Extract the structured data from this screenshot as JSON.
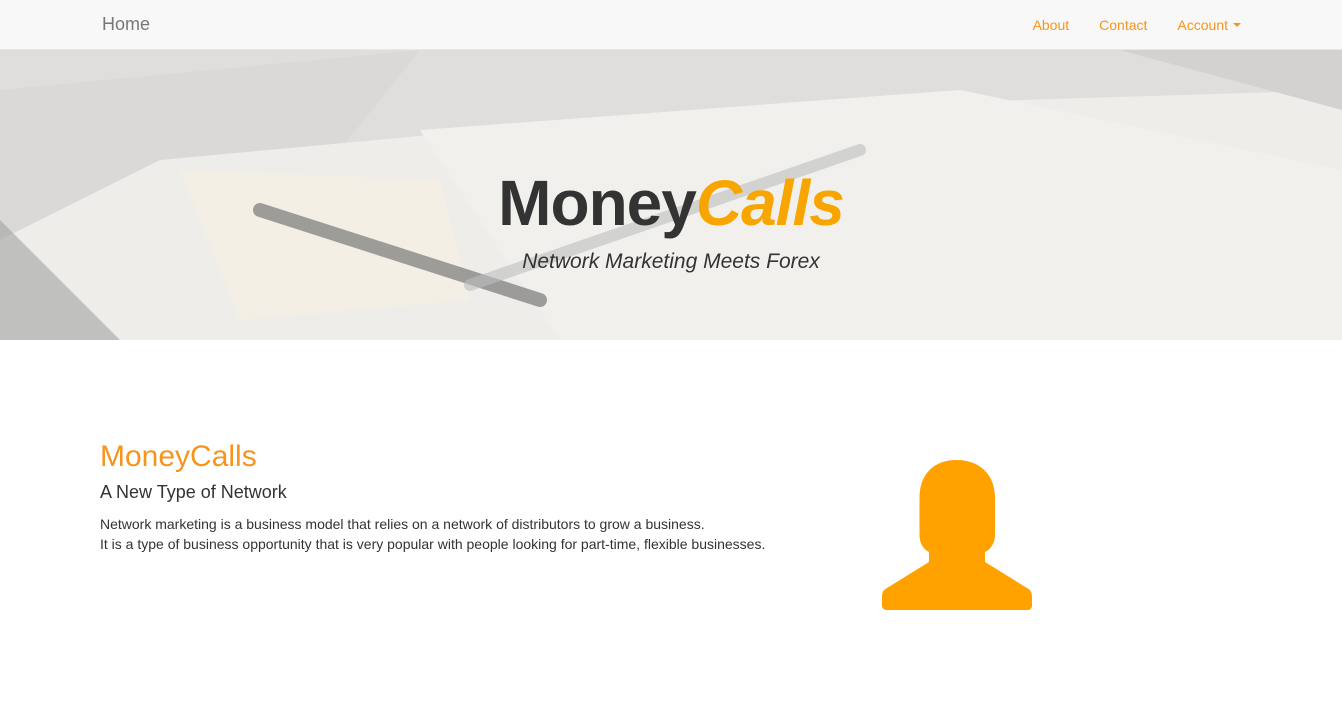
{
  "navbar": {
    "brand": "Home",
    "links": [
      {
        "label": "About"
      },
      {
        "label": "Contact"
      },
      {
        "label": "Account"
      }
    ]
  },
  "hero": {
    "title_main": "Money",
    "title_accent": "Calls",
    "subtitle": "Network Marketing Meets Forex"
  },
  "intro": {
    "title": "MoneyCalls",
    "subtitle": "A New Type of Network",
    "lines": [
      "Network marketing is a business model that relies on a network of distributors to grow a business.",
      "It is a type of business opportunity that is very popular with people looking for part-time, flexible businesses."
    ]
  },
  "avatar": {
    "icon": "user-silhouette-icon"
  },
  "colors": {
    "accent": "#f7941d",
    "avatar": "#ffa200",
    "navbar_bg": "#f8f8f8",
    "text": "#333333"
  }
}
